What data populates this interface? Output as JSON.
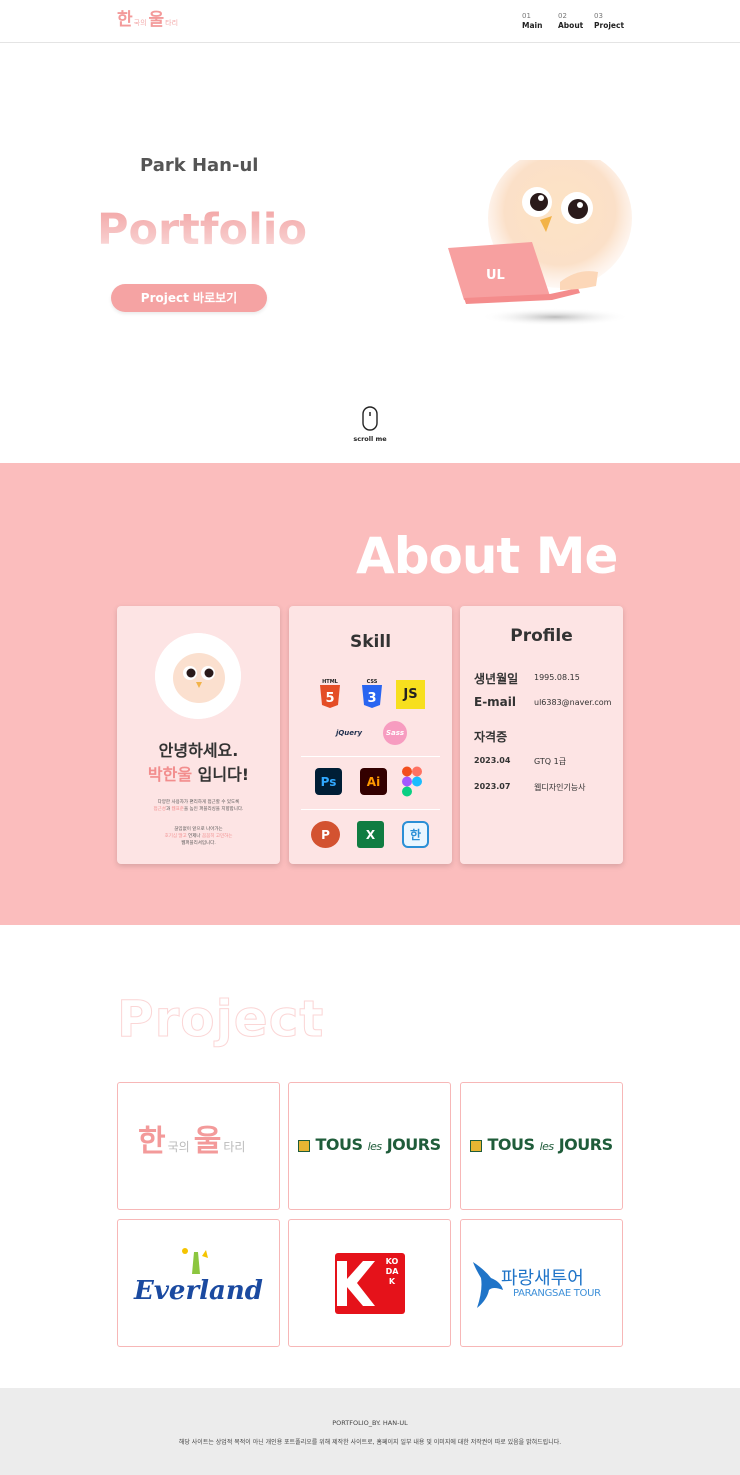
{
  "header": {
    "logo": {
      "c1": "한",
      "s1": "국의",
      "c2": "울",
      "s2": "타리"
    },
    "nav": [
      {
        "num": "01",
        "label": "Main"
      },
      {
        "num": "02",
        "label": "About"
      },
      {
        "num": "03",
        "label": "Project"
      }
    ]
  },
  "hero": {
    "name": "Park Han-ul",
    "title": "Portfolio",
    "button": "Project 바로보기",
    "laptop_text": "UL",
    "scroll": "scroll me"
  },
  "about": {
    "title": "About Me",
    "intro_card": {
      "greeting1": "안녕하세요.",
      "name": "박한울",
      "greeting2_suffix": " 입니다!",
      "p1_line1": "다양한 사용자가 편리하게 접근할 수 있도록",
      "p1_line2_pink1": "접근성",
      "p1_line2_mid": "과 ",
      "p1_line2_pink2": "웹표준",
      "p1_line2_rest": "을 높인 퍼블리싱을 지향합니다.",
      "p2_line1": "끊임없이 앞으로 나아가는",
      "p2_line2_pink1": "호기심 많고",
      "p2_line2_mid": " 언제나 ",
      "p2_line2_pink2": "꼼꼼히 고민하는",
      "p2_line3": "웹퍼블리셔입니다."
    },
    "skill_card": {
      "title": "Skill",
      "icons": [
        "html5-icon",
        "css3-icon",
        "javascript-icon",
        "jquery-icon",
        "sass-icon",
        "photoshop-icon",
        "illustrator-icon",
        "figma-icon",
        "powerpoint-icon",
        "excel-icon",
        "hangul-icon"
      ],
      "labels": {
        "html": "HTML",
        "css": "CSS",
        "js": "JS",
        "jquery": "jQuery",
        "sass": "Sass",
        "ps": "Ps",
        "ai": "Ai",
        "ppt": "P",
        "xls": "X",
        "hwp": "한"
      }
    },
    "profile_card": {
      "title": "Profile",
      "birth_key": "생년월일",
      "birth_val": "1995.08.15",
      "email_key": "E-mail",
      "email_val": "ul6383@naver.com",
      "cert_title": "자격증",
      "certs": [
        {
          "date": "2023.04",
          "name": "GTQ 1급"
        },
        {
          "date": "2023.07",
          "name": "웹디자인기능사"
        }
      ]
    }
  },
  "project": {
    "title": "Project",
    "items": [
      {
        "name": "hanul-tari",
        "logo": {
          "c1": "한",
          "s1": "국의",
          "c2": "울",
          "s2": "타리"
        }
      },
      {
        "name": "tous-les-jours",
        "logo": {
          "a": "TOUS",
          "b": "les",
          "c": "JOURS"
        }
      },
      {
        "name": "tous-les-jours-2",
        "logo": {
          "a": "TOUS",
          "b": "les",
          "c": "JOURS"
        }
      },
      {
        "name": "everland",
        "logo": {
          "text": "Everland"
        }
      },
      {
        "name": "kodak",
        "logo": {
          "text": "KODAK"
        }
      },
      {
        "name": "parangsae-tour",
        "logo": {
          "ko": "파랑새투어",
          "en": "PARANGSAE TOUR"
        }
      }
    ]
  },
  "footer": {
    "line1": "PORTFOLIO_BY. HAN-UL",
    "line2": "해당 사이트는 상업적 목적이 아닌 개인용 포트폴리오를 위해 제작한 사이트로, 홈페이지 일부 내용 및 이미지에 대한 저작권이 따로 있음을 밝혀드립니다."
  },
  "colors": {
    "accent": "#f5a3a3",
    "about_bg": "#fbbdbd",
    "card_bg": "#fde4e4",
    "footer_bg": "#ececec"
  }
}
